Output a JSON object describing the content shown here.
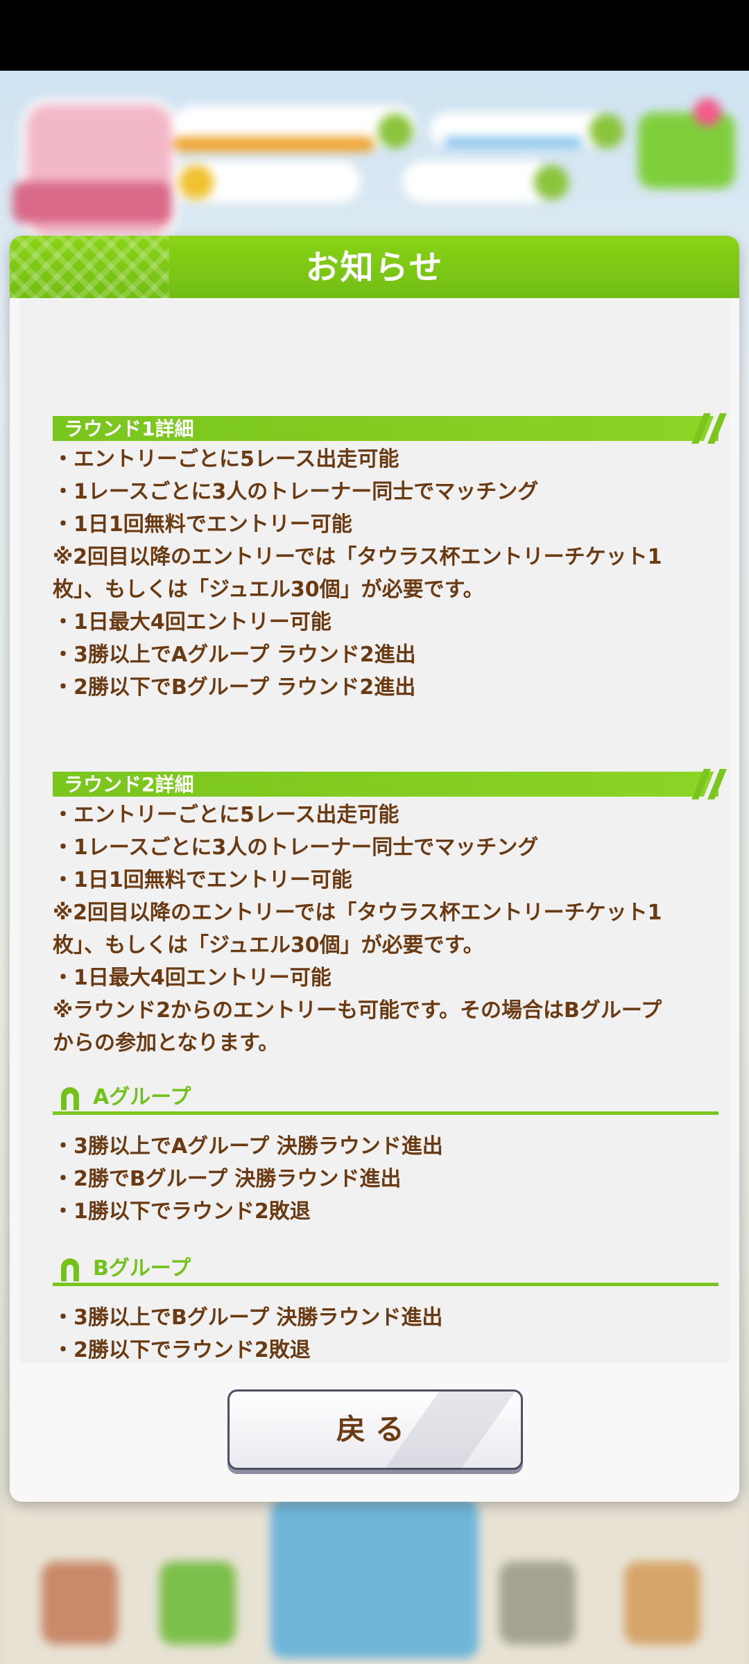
{
  "dialog": {
    "title": "お知らせ",
    "back_label": "戻る"
  },
  "round1": {
    "heading": "ラウンド1詳細",
    "lines": [
      "・エントリーごとに5レース出走可能",
      "・1レースごとに3人のトレーナー同士でマッチング",
      "・1日1回無料でエントリー可能",
      "※2回目以降のエントリーでは「タウラス杯エントリーチケット1",
      "枚」、もしくは「ジュエル30個」が必要です。",
      "・1日最大4回エントリー可能",
      "・3勝以上でAグループ ラウンド2進出",
      "・2勝以下でBグループ ラウンド2進出"
    ]
  },
  "round2": {
    "heading": "ラウンド2詳細",
    "lines": [
      "・エントリーごとに5レース出走可能",
      "・1レースごとに3人のトレーナー同士でマッチング",
      "・1日1回無料でエントリー可能",
      "※2回目以降のエントリーでは「タウラス杯エントリーチケット1",
      "枚」、もしくは「ジュエル30個」が必要です。",
      "・1日最大4回エントリー可能",
      "※ラウンド2からのエントリーも可能です。その場合はBグループ",
      "からの参加となります。"
    ]
  },
  "group_a": {
    "label": "Aグループ",
    "lines": [
      "・3勝以上でAグループ 決勝ラウンド進出",
      "・2勝でBグループ 決勝ラウンド進出",
      "・1勝以下でラウンド2敗退"
    ]
  },
  "group_b": {
    "label": "Bグループ",
    "lines": [
      "・3勝以上でBグループ 決勝ラウンド進出",
      "・2勝以下でラウンド2敗退"
    ]
  },
  "colors": {
    "accent_green": "#7ac51e",
    "text_brown": "#6a3a12"
  }
}
